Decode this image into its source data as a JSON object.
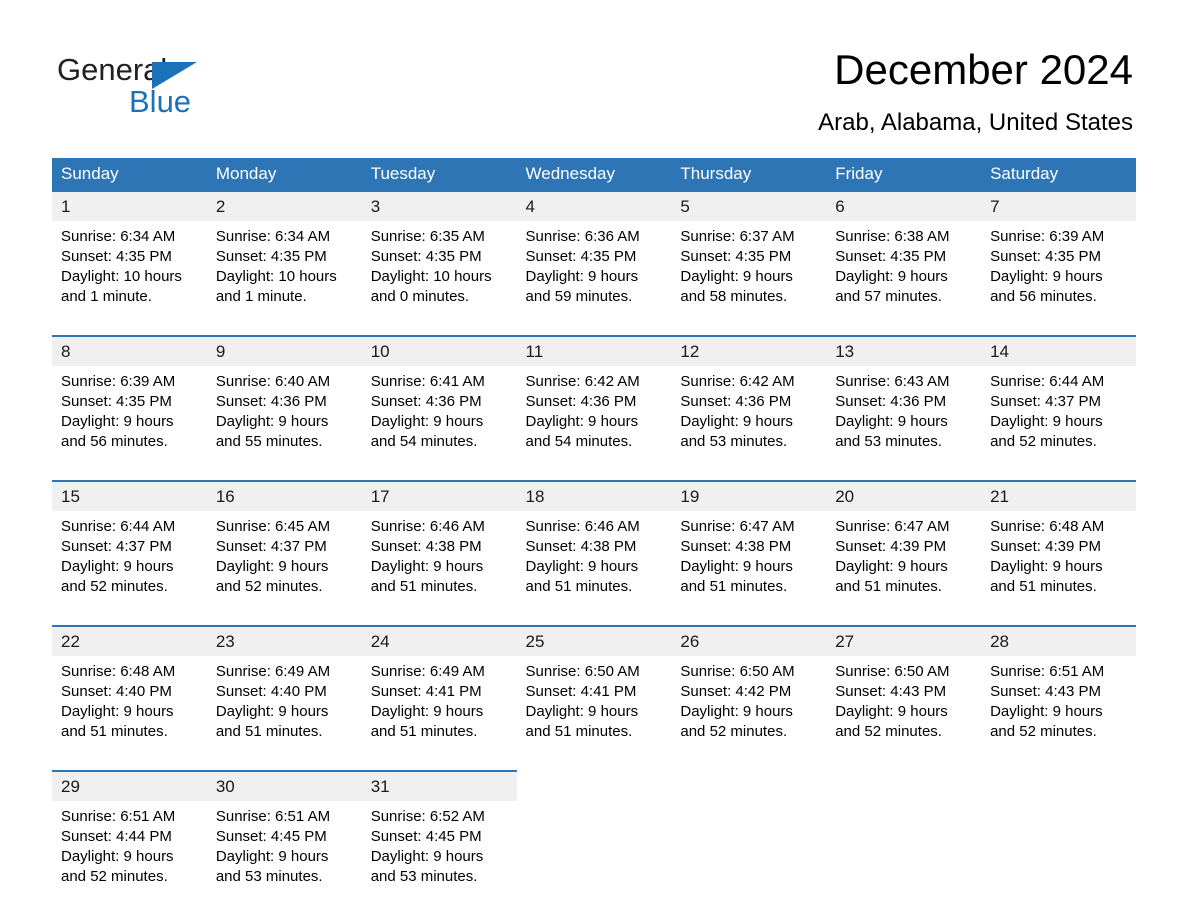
{
  "logo": {
    "line1": "General",
    "line2": "Blue",
    "triangle_color": "#1b72b8"
  },
  "header": {
    "title": "December 2024",
    "subtitle": "Arab, Alabama, United States"
  },
  "colors": {
    "header_blue": "#2e75b6",
    "daynum_band": "#f0f0f0",
    "cell_background": "#ffffff",
    "text": "#000000"
  },
  "weekdays": [
    "Sunday",
    "Monday",
    "Tuesday",
    "Wednesday",
    "Thursday",
    "Friday",
    "Saturday"
  ],
  "weeks": [
    [
      {
        "day": "1",
        "sunrise": "Sunrise: 6:34 AM",
        "sunset": "Sunset: 4:35 PM",
        "daylight": "Daylight: 10 hours and 1 minute."
      },
      {
        "day": "2",
        "sunrise": "Sunrise: 6:34 AM",
        "sunset": "Sunset: 4:35 PM",
        "daylight": "Daylight: 10 hours and 1 minute."
      },
      {
        "day": "3",
        "sunrise": "Sunrise: 6:35 AM",
        "sunset": "Sunset: 4:35 PM",
        "daylight": "Daylight: 10 hours and 0 minutes."
      },
      {
        "day": "4",
        "sunrise": "Sunrise: 6:36 AM",
        "sunset": "Sunset: 4:35 PM",
        "daylight": "Daylight: 9 hours and 59 minutes."
      },
      {
        "day": "5",
        "sunrise": "Sunrise: 6:37 AM",
        "sunset": "Sunset: 4:35 PM",
        "daylight": "Daylight: 9 hours and 58 minutes."
      },
      {
        "day": "6",
        "sunrise": "Sunrise: 6:38 AM",
        "sunset": "Sunset: 4:35 PM",
        "daylight": "Daylight: 9 hours and 57 minutes."
      },
      {
        "day": "7",
        "sunrise": "Sunrise: 6:39 AM",
        "sunset": "Sunset: 4:35 PM",
        "daylight": "Daylight: 9 hours and 56 minutes."
      }
    ],
    [
      {
        "day": "8",
        "sunrise": "Sunrise: 6:39 AM",
        "sunset": "Sunset: 4:35 PM",
        "daylight": "Daylight: 9 hours and 56 minutes."
      },
      {
        "day": "9",
        "sunrise": "Sunrise: 6:40 AM",
        "sunset": "Sunset: 4:36 PM",
        "daylight": "Daylight: 9 hours and 55 minutes."
      },
      {
        "day": "10",
        "sunrise": "Sunrise: 6:41 AM",
        "sunset": "Sunset: 4:36 PM",
        "daylight": "Daylight: 9 hours and 54 minutes."
      },
      {
        "day": "11",
        "sunrise": "Sunrise: 6:42 AM",
        "sunset": "Sunset: 4:36 PM",
        "daylight": "Daylight: 9 hours and 54 minutes."
      },
      {
        "day": "12",
        "sunrise": "Sunrise: 6:42 AM",
        "sunset": "Sunset: 4:36 PM",
        "daylight": "Daylight: 9 hours and 53 minutes."
      },
      {
        "day": "13",
        "sunrise": "Sunrise: 6:43 AM",
        "sunset": "Sunset: 4:36 PM",
        "daylight": "Daylight: 9 hours and 53 minutes."
      },
      {
        "day": "14",
        "sunrise": "Sunrise: 6:44 AM",
        "sunset": "Sunset: 4:37 PM",
        "daylight": "Daylight: 9 hours and 52 minutes."
      }
    ],
    [
      {
        "day": "15",
        "sunrise": "Sunrise: 6:44 AM",
        "sunset": "Sunset: 4:37 PM",
        "daylight": "Daylight: 9 hours and 52 minutes."
      },
      {
        "day": "16",
        "sunrise": "Sunrise: 6:45 AM",
        "sunset": "Sunset: 4:37 PM",
        "daylight": "Daylight: 9 hours and 52 minutes."
      },
      {
        "day": "17",
        "sunrise": "Sunrise: 6:46 AM",
        "sunset": "Sunset: 4:38 PM",
        "daylight": "Daylight: 9 hours and 51 minutes."
      },
      {
        "day": "18",
        "sunrise": "Sunrise: 6:46 AM",
        "sunset": "Sunset: 4:38 PM",
        "daylight": "Daylight: 9 hours and 51 minutes."
      },
      {
        "day": "19",
        "sunrise": "Sunrise: 6:47 AM",
        "sunset": "Sunset: 4:38 PM",
        "daylight": "Daylight: 9 hours and 51 minutes."
      },
      {
        "day": "20",
        "sunrise": "Sunrise: 6:47 AM",
        "sunset": "Sunset: 4:39 PM",
        "daylight": "Daylight: 9 hours and 51 minutes."
      },
      {
        "day": "21",
        "sunrise": "Sunrise: 6:48 AM",
        "sunset": "Sunset: 4:39 PM",
        "daylight": "Daylight: 9 hours and 51 minutes."
      }
    ],
    [
      {
        "day": "22",
        "sunrise": "Sunrise: 6:48 AM",
        "sunset": "Sunset: 4:40 PM",
        "daylight": "Daylight: 9 hours and 51 minutes."
      },
      {
        "day": "23",
        "sunrise": "Sunrise: 6:49 AM",
        "sunset": "Sunset: 4:40 PM",
        "daylight": "Daylight: 9 hours and 51 minutes."
      },
      {
        "day": "24",
        "sunrise": "Sunrise: 6:49 AM",
        "sunset": "Sunset: 4:41 PM",
        "daylight": "Daylight: 9 hours and 51 minutes."
      },
      {
        "day": "25",
        "sunrise": "Sunrise: 6:50 AM",
        "sunset": "Sunset: 4:41 PM",
        "daylight": "Daylight: 9 hours and 51 minutes."
      },
      {
        "day": "26",
        "sunrise": "Sunrise: 6:50 AM",
        "sunset": "Sunset: 4:42 PM",
        "daylight": "Daylight: 9 hours and 52 minutes."
      },
      {
        "day": "27",
        "sunrise": "Sunrise: 6:50 AM",
        "sunset": "Sunset: 4:43 PM",
        "daylight": "Daylight: 9 hours and 52 minutes."
      },
      {
        "day": "28",
        "sunrise": "Sunrise: 6:51 AM",
        "sunset": "Sunset: 4:43 PM",
        "daylight": "Daylight: 9 hours and 52 minutes."
      }
    ],
    [
      {
        "day": "29",
        "sunrise": "Sunrise: 6:51 AM",
        "sunset": "Sunset: 4:44 PM",
        "daylight": "Daylight: 9 hours and 52 minutes."
      },
      {
        "day": "30",
        "sunrise": "Sunrise: 6:51 AM",
        "sunset": "Sunset: 4:45 PM",
        "daylight": "Daylight: 9 hours and 53 minutes."
      },
      {
        "day": "31",
        "sunrise": "Sunrise: 6:52 AM",
        "sunset": "Sunset: 4:45 PM",
        "daylight": "Daylight: 9 hours and 53 minutes."
      },
      {
        "day": "",
        "sunrise": "",
        "sunset": "",
        "daylight": ""
      },
      {
        "day": "",
        "sunrise": "",
        "sunset": "",
        "daylight": ""
      },
      {
        "day": "",
        "sunrise": "",
        "sunset": "",
        "daylight": ""
      },
      {
        "day": "",
        "sunrise": "",
        "sunset": "",
        "daylight": ""
      }
    ]
  ]
}
